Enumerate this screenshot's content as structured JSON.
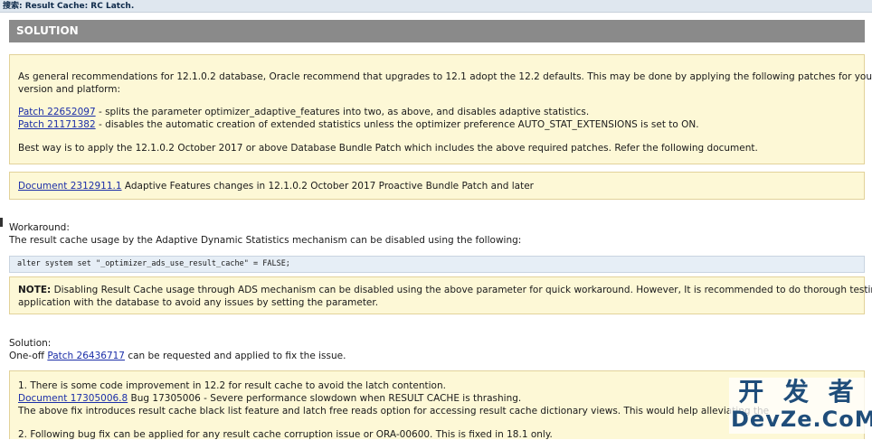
{
  "topbar": {
    "title": "搜索: Result Cache: RC Latch."
  },
  "solution": {
    "header": "SOLUTION",
    "intro_line1": "As general recommendations for 12.1.0.2 database, Oracle recommend that upgrades to 12.1 adopt the 12.2 defaults. This may be done by applying the following patches for your",
    "intro_line2": "version and platform:",
    "patch1_link": "Patch 22652097",
    "patch1_text": " - splits the parameter optimizer_adaptive_features into two, as above, and disables adaptive statistics.",
    "patch2_link": "Patch 21171382",
    "patch2_text": " - disables the automatic creation of extended statistics unless the optimizer preference AUTO_STAT_EXTENSIONS is set to ON.",
    "best_way": "Best way is to apply the 12.1.0.2 October 2017 or above Database Bundle Patch which includes the above required patches. Refer the following document.",
    "doc_link": "Document 2312911.1",
    "doc_text": " Adaptive Features changes in 12.1.0.2 October 2017 Proactive Bundle Patch and later"
  },
  "workaround": {
    "title": "Workaround:",
    "text": "The result cache usage by the Adaptive Dynamic Statistics mechanism can be disabled using the following:",
    "code": "alter system set \"_optimizer_ads_use_result_cache\" = FALSE;",
    "note_label": "NOTE:",
    "note_line1": " Disabling Result Cache usage through ADS mechanism can be disabled using the above parameter for quick workaround. However, It is recommended to do thorough testing of",
    "note_line2": "application with the database to avoid any issues by setting the parameter."
  },
  "solution2": {
    "title": "Solution:",
    "prefix": "One-off ",
    "patch_link": "Patch 26436717",
    "suffix": " can be requested and applied to fix the issue.",
    "item1": "1. There is some code improvement in 12.2 for result cache to avoid the latch contention.",
    "doc_link": "Document 17305006.8",
    "doc_text": " Bug 17305006 - Severe performance slowdown when RESULT CACHE is thrashing.",
    "fix_text": "The above fix introduces result cache black list feature and latch free reads option for accessing result cache dictionary views. This would help alleviating the",
    "item2": "2. Following bug fix can be applied for any result cache corruption issue or ORA-00600. This is fixed in 18.1 only."
  },
  "watermark": {
    "cn": "开 发 者",
    "en": "DevZe.CoM"
  }
}
